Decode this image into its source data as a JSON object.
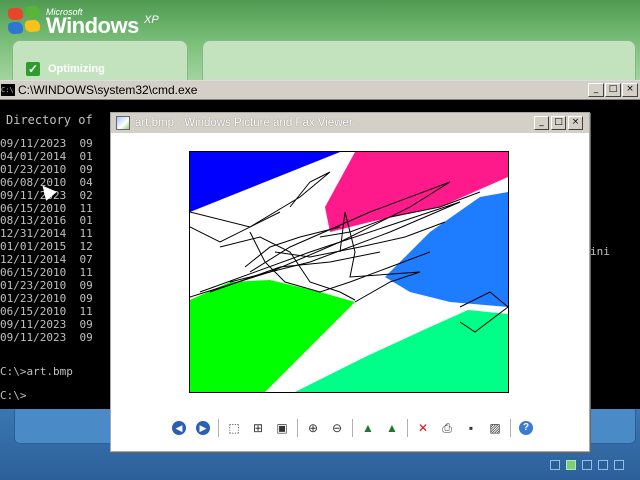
{
  "desktop": {
    "brand_small": "Microsoft",
    "brand_large": "Windows",
    "brand_xp": "XP",
    "status_text": "Optimizing"
  },
  "cmd": {
    "title": "C:\\WINDOWS\\system32\\cmd.exe",
    "icon_text": "C:\\",
    "directory_header": "Directory of",
    "listing": [
      "09/11/2023  09",
      "04/01/2014  01",
      "01/23/2010  09",
      "06/08/2010  04",
      "09/11/2023  02",
      "06/15/2010  11",
      "08/13/2016  01",
      "12/31/2014  11",
      "01/01/2015  12",
      "12/11/2014  07",
      "06/15/2010  11",
      "01/23/2010  09",
      "01/23/2010  09",
      "06/15/2010  11",
      "09/11/2023  09",
      "09/11/2023  09"
    ],
    "partial_text_right": "ini",
    "prompt_command": "C:\\>art.bmp",
    "prompt_empty": "C:\\>",
    "controls": {
      "minimize": "_",
      "maximize": "□",
      "close": "×"
    }
  },
  "viewer": {
    "title": "art.bmp - Windows Picture and Fax Viewer",
    "controls": {
      "minimize": "_",
      "maximize": "□",
      "close": "×"
    },
    "toolbar": [
      {
        "name": "previous-image-button",
        "icon": "◀"
      },
      {
        "name": "next-image-button",
        "icon": "▶"
      },
      {
        "name": "best-fit-button",
        "icon": "⬚"
      },
      {
        "name": "actual-size-button",
        "icon": "⊞"
      },
      {
        "name": "slideshow-button",
        "icon": "▣"
      },
      {
        "name": "zoom-in-button",
        "icon": "⊕"
      },
      {
        "name": "zoom-out-button",
        "icon": "⊖"
      },
      {
        "name": "rotate-clockwise-button",
        "icon": "▲"
      },
      {
        "name": "rotate-counterclockwise-button",
        "icon": "▲"
      },
      {
        "name": "delete-button",
        "icon": "✕"
      },
      {
        "name": "print-button",
        "icon": "⎙"
      },
      {
        "name": "save-button",
        "icon": "▪"
      },
      {
        "name": "edit-button",
        "icon": "▨"
      },
      {
        "name": "help-button",
        "icon": "?"
      }
    ],
    "art_colors": {
      "blue": "#0000ff",
      "magenta": "#ff1a8c",
      "azure": "#1e7cff",
      "green": "#00ff00",
      "spring_green": "#00ff88",
      "lines": "#000000"
    }
  },
  "colors": {
    "cmd_background": "#000000",
    "cmd_text": "#c0c0c0",
    "titlebar_inactive": "#d4d0c8"
  }
}
